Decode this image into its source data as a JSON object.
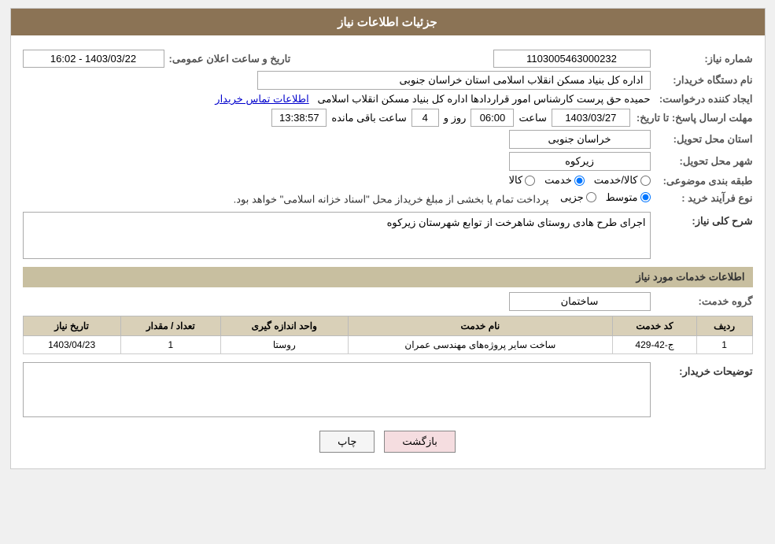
{
  "header": {
    "title": "جزئیات اطلاعات نیاز"
  },
  "fields": {
    "shomareNiaz_label": "شماره نیاز:",
    "shomareNiaz_value": "1103005463000232",
    "namDastgah_label": "نام دستگاه خریدار:",
    "namDastgah_value": "اداره کل بنیاد مسکن انقلاب اسلامی استان خراسان جنوبی",
    "ijadKonande_label": "ایجاد کننده درخواست:",
    "ijadKonande_value": "حمیده حق پرست کارشناس امور قراردادها اداره کل بنیاد مسکن انقلاب اسلامی",
    "ijadKonande_link": "اطلاعات تماس خریدار",
    "mohlat_label": "مهلت ارسال پاسخ: تا تاریخ:",
    "mohlat_date": "1403/03/27",
    "mohlat_saat_label": "ساعت",
    "mohlat_saat": "06:00",
    "mohlat_roz_label": "روز و",
    "mohlat_roz": "4",
    "mohlat_baghiمانده_label": "ساعت باقی مانده",
    "mohlat_baqi": "13:38:57",
    "tarikh_label": "تاریخ و ساعت اعلان عمومی:",
    "tarikh_value": "1403/03/22 - 16:02",
    "ostan_label": "استان محل تحویل:",
    "ostan_value": "خراسان جنوبی",
    "shahr_label": "شهر محل تحویل:",
    "shahr_value": "زیرکوه",
    "tabaghebandi_label": "طبقه بندی موضوعی:",
    "tabaghebandi_kala": "کالا",
    "tabaghebandi_khadamat": "خدمت",
    "tabaghebandi_kala_khadamat": "کالا/خدمت",
    "tabaghebandi_selected": "khadamat",
    "noeFarayand_label": "نوع فرآیند خرید :",
    "noeFarayand_jozei": "جزیی",
    "noeFarayand_motavaset": "متوسط",
    "noeFarayand_selected": "motavaset",
    "noeFarayand_note": "پرداخت تمام یا بخشی از مبلغ خریداز محل \"اسناد خزانه اسلامی\" خواهد بود.",
    "sharhKolli_label": "شرح کلی نیاز:",
    "sharhKolli_value": "اجرای طرح هادی روستای شاهرخت از توابع شهرستان زیرکوه",
    "services_label": "اطلاعات خدمات مورد نیاز",
    "groupKhadamat_label": "گروه خدمت:",
    "groupKhadamat_value": "ساختمان",
    "table": {
      "headers": [
        "ردیف",
        "کد خدمت",
        "نام خدمت",
        "واحد اندازه گیری",
        "تعداد / مقدار",
        "تاریخ نیاز"
      ],
      "rows": [
        {
          "radif": "1",
          "kod": "ج-42-429",
          "nam": "ساخت سایر پروژه‌های مهندسی عمران",
          "vahed": "روستا",
          "tedad": "1",
          "tarikh": "1403/04/23"
        }
      ]
    },
    "tawsif_label": "توضیحات خریدار:",
    "tawsif_value": ""
  },
  "buttons": {
    "print": "چاپ",
    "back": "بازگشت"
  }
}
